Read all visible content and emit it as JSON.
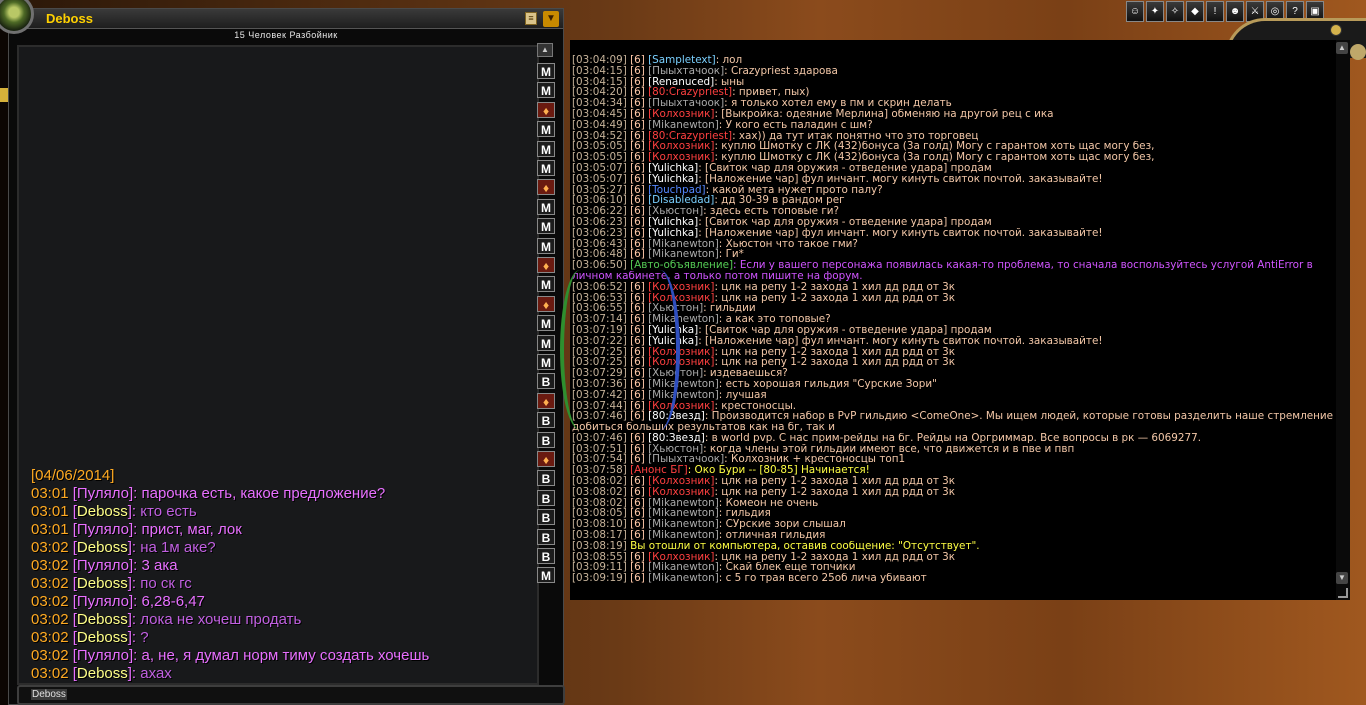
{
  "whisper": {
    "name": "Deboss",
    "subtitle": "15 Человек Разбойник",
    "date": "[04/06/2014]",
    "input_value": "Deboss",
    "messages": [
      {
        "time": "03:01",
        "who": "Пуляло",
        "dir": "in",
        "text": "парочка есть, какое предложение?"
      },
      {
        "time": "03:01",
        "who": "Deboss",
        "dir": "out",
        "text": "кто есть"
      },
      {
        "time": "03:01",
        "who": "Пуляло",
        "dir": "in",
        "text": "прист, маг, лок"
      },
      {
        "time": "03:02",
        "who": "Deboss",
        "dir": "out",
        "text": "на 1м аке?"
      },
      {
        "time": "03:02",
        "who": "Пуляло",
        "dir": "in",
        "text": "3 ака"
      },
      {
        "time": "03:02",
        "who": "Deboss",
        "dir": "out",
        "text": "по ск гс"
      },
      {
        "time": "03:02",
        "who": "Пуляло",
        "dir": "in",
        "text": "6,28-6,47"
      },
      {
        "time": "03:02",
        "who": "Deboss",
        "dir": "out",
        "text": "лока не хочеш продать"
      },
      {
        "time": "03:02",
        "who": "Deboss",
        "dir": "out",
        "text": "?"
      },
      {
        "time": "03:02",
        "who": "Пуляло",
        "dir": "in",
        "text": "а, не, я думал норм тиму создать хочешь"
      },
      {
        "time": "03:02",
        "who": "Deboss",
        "dir": "out",
        "text": "ахах"
      }
    ],
    "tabs": [
      "M",
      "M",
      "S",
      "M",
      "M",
      "M",
      "S",
      "M",
      "M",
      "M",
      "S",
      "M",
      "S",
      "M",
      "M",
      "M",
      "B",
      "S",
      "B",
      "B",
      "S",
      "B",
      "B",
      "B",
      "B",
      "B",
      "M"
    ]
  },
  "chat": {
    "lines": [
      {
        "t": "[03:04:09]",
        "c": "[6]",
        "n": "[Sampletext]",
        "nc": "pn",
        "m": ": лол"
      },
      {
        "t": "[03:04:15]",
        "c": "[6]",
        "n": "[Пыыхтачоок]",
        "nc": "pg",
        "m": ":  Crazypriest здарова"
      },
      {
        "t": "[03:04:15]",
        "c": "[6]",
        "n": "[Renanuced]",
        "nc": "pw",
        "m": ": ыны"
      },
      {
        "t": "[03:04:20]",
        "c": "[6]",
        "n": "[80:Crazypriest]",
        "nc": "pr",
        "m": ": привет, пых)"
      },
      {
        "t": "[03:04:34]",
        "c": "[6]",
        "n": "[Пыыхтачоок]",
        "nc": "pg",
        "m": ": я только хотел ему в пм и скрин делать"
      },
      {
        "t": "[03:04:45]",
        "c": "[6]",
        "n": "[Колхозник]",
        "nc": "pr",
        "m": ":  [Выкройка: одеяние Мерлина] обменяю на другой рец с ика"
      },
      {
        "t": "[03:04:49]",
        "c": "[6]",
        "n": "[Mikanewton]",
        "nc": "pg",
        "m": ": У кого есть паладин с шм?"
      },
      {
        "t": "[03:04:52]",
        "c": "[6]",
        "n": "[80:Crazypriest]",
        "nc": "pr",
        "m": ": хах)) да тут итак понятно что это торговец"
      },
      {
        "t": "[03:05:05]",
        "c": "[6]",
        "n": "[Колхозник]",
        "nc": "pr",
        "m": ": куплю Шмотку с ЛК (432)бонуса (3а голд) Могу с гарантом хоть щас могу без,"
      },
      {
        "t": "[03:05:05]",
        "c": "[6]",
        "n": "[Колхозник]",
        "nc": "pr",
        "m": ": куплю Шмотку с ЛК (432)бонуса (3а голд) Могу с гарантом хоть щас могу без,"
      },
      {
        "t": "[03:05:07]",
        "c": "[6]",
        "n": "[Yulichka]",
        "nc": "pw",
        "m": ":  [Свиток чар для оружия - отведение удара] продам"
      },
      {
        "t": "[03:05:07]",
        "c": "[6]",
        "n": "[Yulichka]",
        "nc": "pw",
        "m": ": [Наложение чар] фул инчант. могу кинуть свиток почтой. заказывайте!"
      },
      {
        "t": "[03:05:27]",
        "c": "[6]",
        "n": "[Touchpad]",
        "nc": "pb",
        "m": ": какой мета нужет прото палу?"
      },
      {
        "t": "[03:06:10]",
        "c": "[6]",
        "n": "[Disabledad]",
        "nc": "pn",
        "m": ": дд 30-39 в рандом рег"
      },
      {
        "t": "[03:06:22]",
        "c": "[6]",
        "n": "[Хьюстон]",
        "nc": "pg",
        "m": ": здесь есть топовые ги?"
      },
      {
        "t": "[03:06:23]",
        "c": "[6]",
        "n": "[Yulichka]",
        "nc": "pw",
        "m": ":  [Свиток чар для оружия - отведение удара] продам"
      },
      {
        "t": "[03:06:23]",
        "c": "[6]",
        "n": "[Yulichka]",
        "nc": "pw",
        "m": ": [Наложение чар] фул инчант. могу кинуть свиток почтой. заказывайте!"
      },
      {
        "t": "[03:06:43]",
        "c": "[6]",
        "n": "[Mikanewton]",
        "nc": "pg",
        "m": ":  Хьюстон что такое гми?"
      },
      {
        "t": "[03:06:48]",
        "c": "[6]",
        "n": "[Mikanewton]",
        "nc": "pg",
        "m": ": Ги*"
      },
      {
        "t": "[03:06:50]",
        "c": "",
        "n": "[Авто-объявление]",
        "nc": "pgr",
        "m": ": Если у вашего персонажа появилась какая-то проблема, то сначала воспользуйтесь услугой AntiError в",
        "mc": "ppurple"
      },
      {
        "t": "",
        "c": "",
        "n": "",
        "nc": "pg",
        "m": "личном кабинете, а только потом пишите на форум.",
        "mc": "ppurple"
      },
      {
        "t": "[03:06:52]",
        "c": "[6]",
        "n": "[Колхозник]",
        "nc": "pr",
        "m": ": цлк на репу 1-2 захода 1 хил дд рдд от 3к"
      },
      {
        "t": "[03:06:53]",
        "c": "[6]",
        "n": "[Колхозник]",
        "nc": "pr",
        "m": ": цлк на репу 1-2 захода 1 хил дд рдд от 3к"
      },
      {
        "t": "[03:06:55]",
        "c": "[6]",
        "n": "[Хьюстон]",
        "nc": "pg",
        "m": ": гильдии"
      },
      {
        "t": "[03:07:14]",
        "c": "[6]",
        "n": "[Mikanewton]",
        "nc": "pg",
        "m": ": а как это топовые?"
      },
      {
        "t": "[03:07:19]",
        "c": "[6]",
        "n": "[Yulichka]",
        "nc": "pw",
        "m": ":  [Свиток чар для оружия - отведение удара] продам"
      },
      {
        "t": "[03:07:22]",
        "c": "[6]",
        "n": "[Yulichka]",
        "nc": "pw",
        "m": ": [Наложение чар] фул инчант. могу кинуть свиток почтой. заказывайте!"
      },
      {
        "t": "[03:07:25]",
        "c": "[6]",
        "n": "[Колхозник]",
        "nc": "pr",
        "m": ": цлк на репу 1-2 захода 1 хил дд рдд от 3к"
      },
      {
        "t": "[03:07:25]",
        "c": "[6]",
        "n": "[Колхозник]",
        "nc": "pr",
        "m": ": цлк на репу 1-2 захода 1 хил дд рдд от 3к"
      },
      {
        "t": "[03:07:29]",
        "c": "[6]",
        "n": "[Хьюстон]",
        "nc": "pg",
        "m": ": издеваешься?"
      },
      {
        "t": "[03:07:36]",
        "c": "[6]",
        "n": "[Mikanewton]",
        "nc": "pg",
        "m": ": есть хорошая гильдия \"Сурские Зори\""
      },
      {
        "t": "[03:07:42]",
        "c": "[6]",
        "n": "[Mikanewton]",
        "nc": "pg",
        "m": ": лучшая"
      },
      {
        "t": "[03:07:44]",
        "c": "[6]",
        "n": "[Колхозник]",
        "nc": "pr",
        "m": ": крестоносцы."
      },
      {
        "t": "[03:07:46]",
        "c": "[6]",
        "n": "[80:Звезд]",
        "nc": "pw",
        "m": ": Производится набор в PvP гильдию <ComeOne>. Мы ищем людей, которые готовы разделить наше стремление"
      },
      {
        "t": "",
        "c": "",
        "n": "",
        "nc": "pg",
        "m": "добиться больших результатов как на бг, так и"
      },
      {
        "t": "[03:07:46]",
        "c": "[6]",
        "n": "[80:Звезд]",
        "nc": "pw",
        "m": ": в world pvp. С нас прим-рейды на бг. Рейды на Оргриммар. Все вопросы в рк — 6069277."
      },
      {
        "t": "[03:07:51]",
        "c": "[6]",
        "n": "[Хьюстон]",
        "nc": "pg",
        "m": ": когда члены этой гильдии имеют все, что движется и в пве и пвп"
      },
      {
        "t": "[03:07:54]",
        "c": "[6]",
        "n": "[Пыыхтачоок]",
        "nc": "pg",
        "m": ":  Колхозник + крестоносцы топ1"
      },
      {
        "t": "[03:07:58]",
        "c": "",
        "n": "[Анонс БГ]",
        "nc": "pr",
        "m": ": Око Бури -- [80-85]  Начинается!",
        "mc": "pyel"
      },
      {
        "t": "[03:08:02]",
        "c": "[6]",
        "n": "[Колхозник]",
        "nc": "pr",
        "m": ": цлк на репу 1-2 захода 1 хил дд рдд от 3к"
      },
      {
        "t": "[03:08:02]",
        "c": "[6]",
        "n": "[Колхозник]",
        "nc": "pr",
        "m": ": цлк на репу 1-2 захода 1 хил дд рдд от 3к"
      },
      {
        "t": "[03:08:02]",
        "c": "[6]",
        "n": "[Mikanewton]",
        "nc": "pg",
        "m": ": Комеон не очень"
      },
      {
        "t": "[03:08:05]",
        "c": "[6]",
        "n": "[Mikanewton]",
        "nc": "pg",
        "m": ": гильдия"
      },
      {
        "t": "[03:08:10]",
        "c": "[6]",
        "n": "[Mikanewton]",
        "nc": "pg",
        "m": ": СУрские зори слышал"
      },
      {
        "t": "[03:08:17]",
        "c": "[6]",
        "n": "[Mikanewton]",
        "nc": "pg",
        "m": ": отличная гильдия"
      },
      {
        "t": "[03:08:19]",
        "c": "",
        "n": "",
        "nc": "pg",
        "m": "Вы отошли от компьютера, оставив сообщение: \"Отсутствует\".",
        "mc": "pyel"
      },
      {
        "t": "[03:08:55]",
        "c": "[6]",
        "n": "[Колхозник]",
        "nc": "pr",
        "m": ": цлк на репу 1-2 захода 1 хил дд рдд от 3к"
      },
      {
        "t": "[03:09:11]",
        "c": "[6]",
        "n": "[Mikanewton]",
        "nc": "pg",
        "m": ": Скай блек еще топчики"
      },
      {
        "t": "[03:09:19]",
        "c": "[6]",
        "n": "[Mikanewton]",
        "nc": "pg",
        "m": ": с 5 го трая всего 25об лича убивают"
      }
    ]
  },
  "micro_menu": [
    "char",
    "spell",
    "talent",
    "achiev",
    "quest",
    "social",
    "pvp",
    "lfg",
    "help",
    "main"
  ],
  "colors": {
    "accent": "#ffd100",
    "whisper": "#e870ff"
  }
}
